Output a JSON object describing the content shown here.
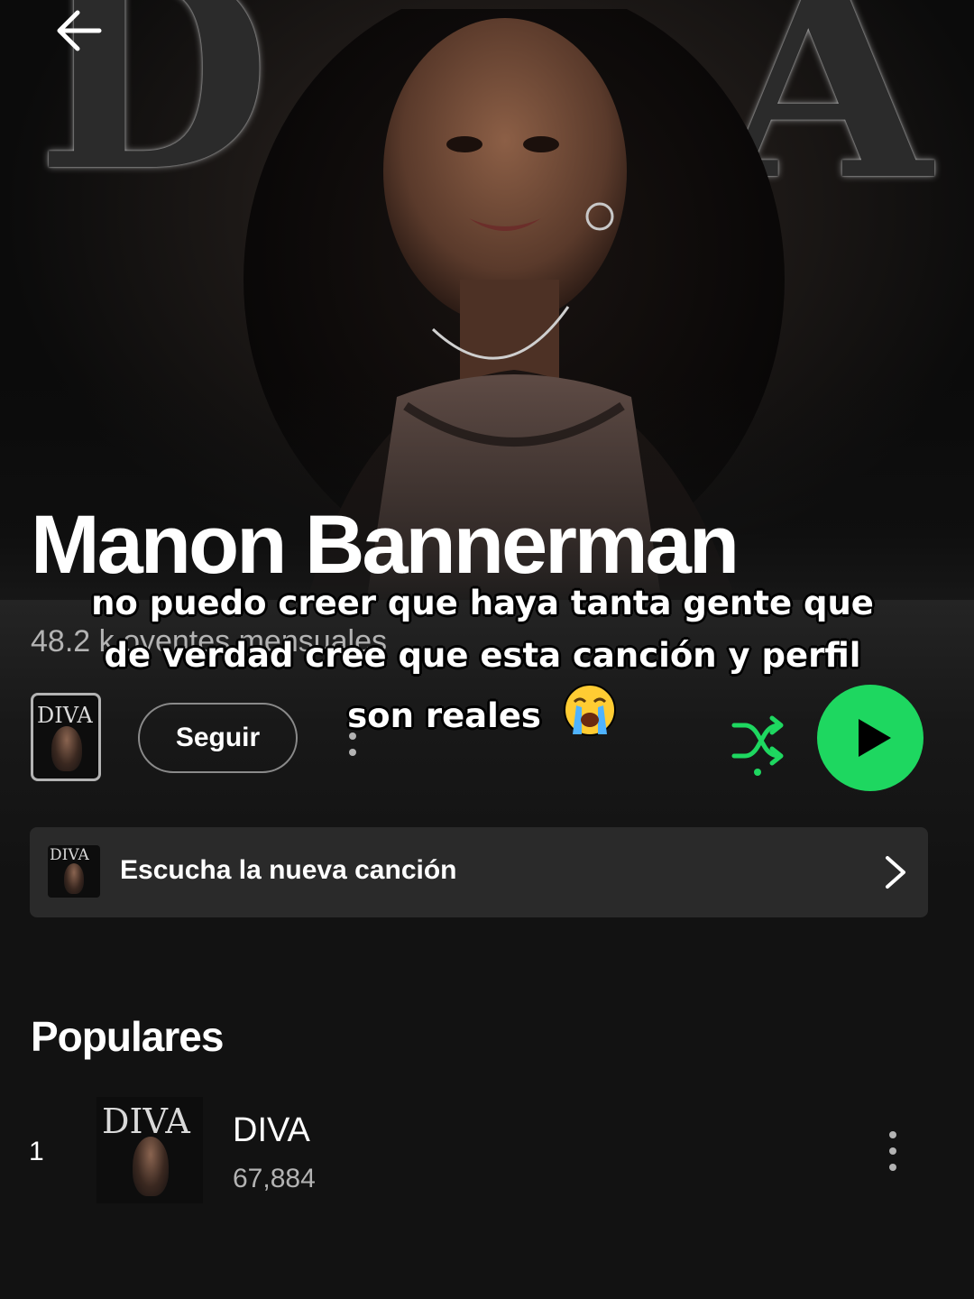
{
  "header": {
    "back_icon": "arrow-left-icon"
  },
  "artist": {
    "name": "Manon Bannerman",
    "monthly_listeners": "48.2 k oyentes mensuales"
  },
  "actions": {
    "follow_label": "Seguir",
    "more_icon": "more-vertical-icon",
    "shuffle_icon": "shuffle-icon",
    "play_icon": "play-icon",
    "accent_color": "#1ed760"
  },
  "cover_art": {
    "text": "DIVA"
  },
  "new_release": {
    "label": "Escucha la nueva canción",
    "icon": "chevron-right-icon"
  },
  "popular": {
    "title": "Populares",
    "tracks": [
      {
        "number": "1",
        "title": "DIVA",
        "plays": "67,884"
      }
    ]
  },
  "overlay_caption": {
    "lines": [
      "no puedo creer que haya tanta gente que",
      "de verdad cree que esta canción y perfil",
      "son reales"
    ],
    "emoji": "loudly-crying-face-emoji"
  }
}
